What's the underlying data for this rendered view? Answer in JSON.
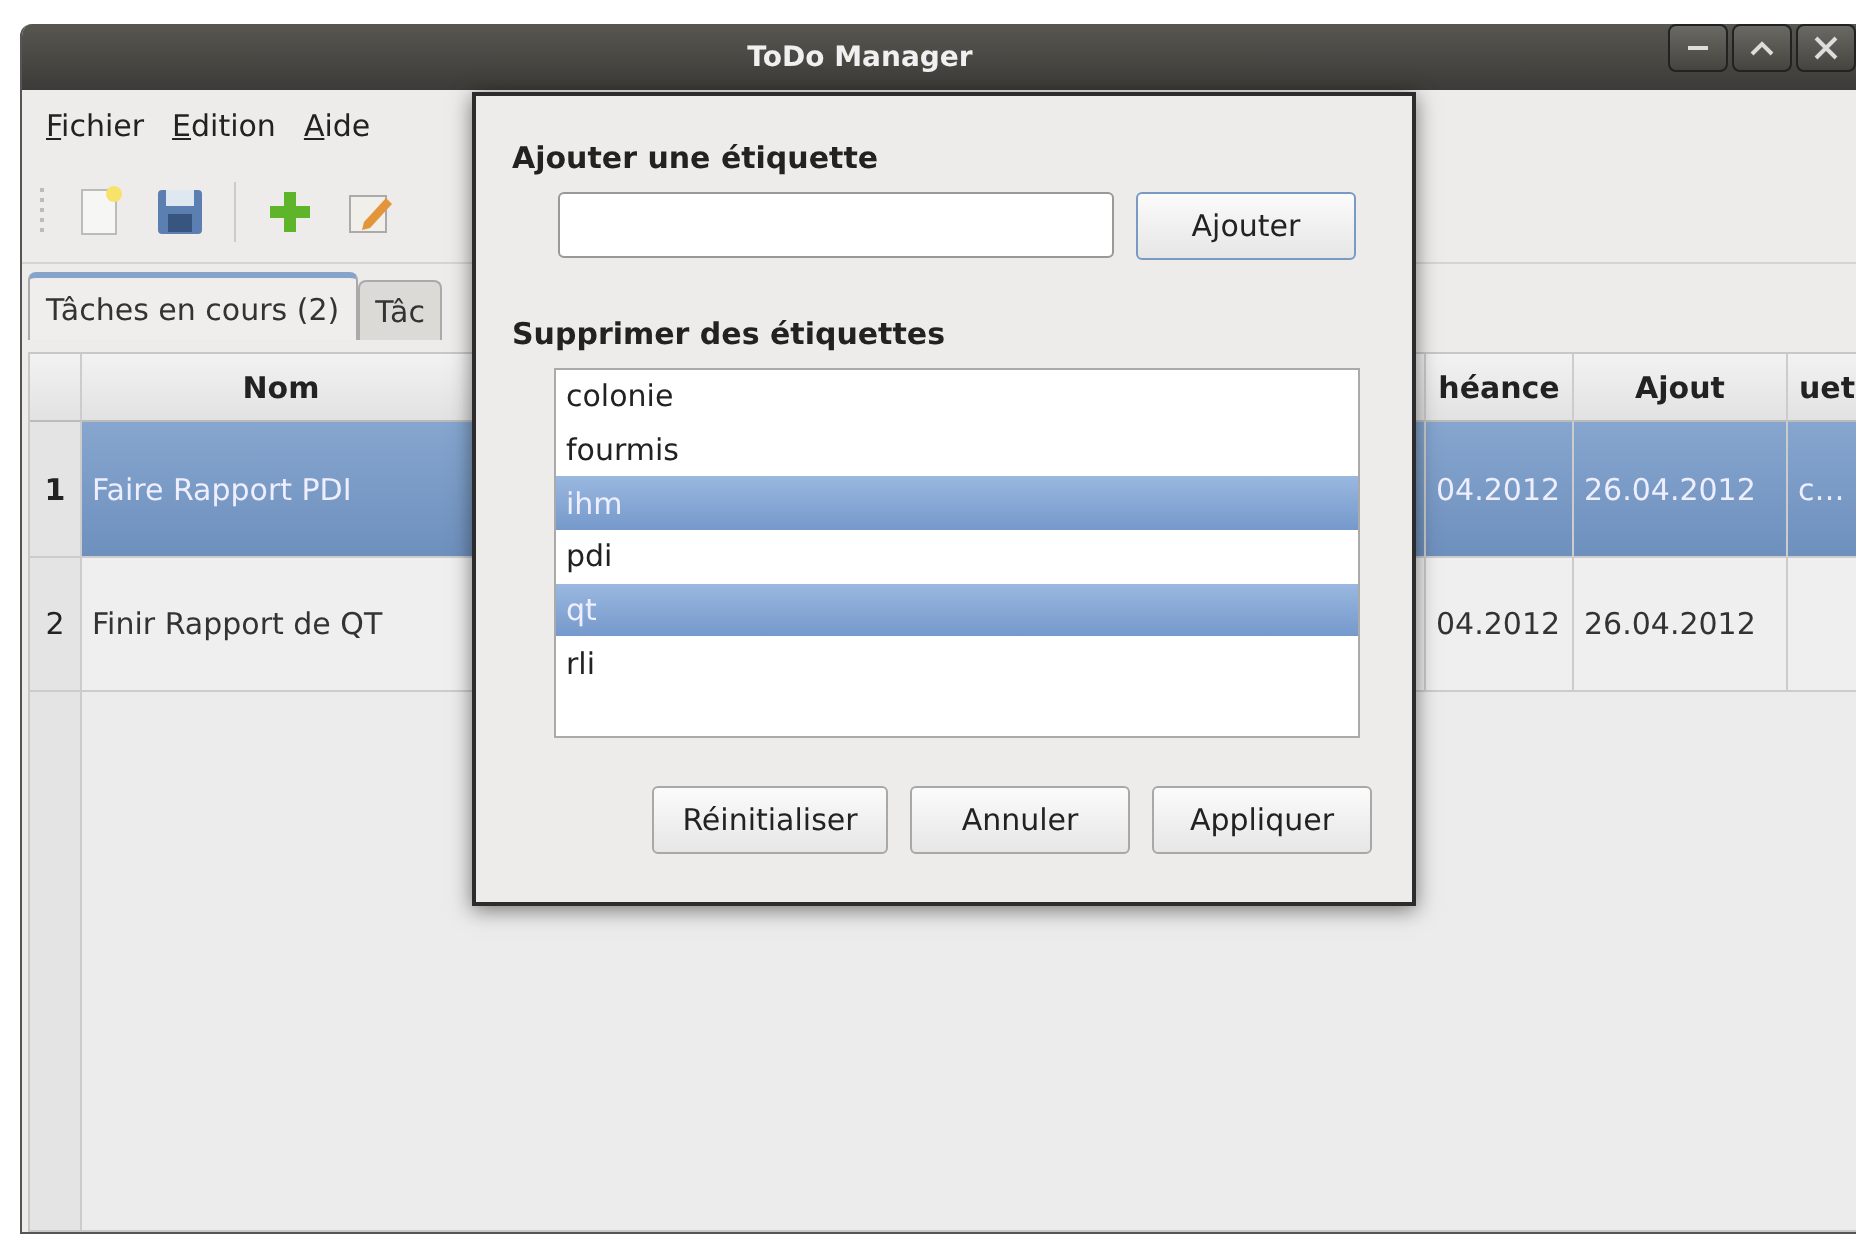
{
  "window": {
    "title": "ToDo Manager"
  },
  "menu": [
    "Fichier",
    "Edition",
    "Aide"
  ],
  "tabs": [
    {
      "label": "Tâches en cours (2)",
      "selected": true
    },
    {
      "label": "Tâc",
      "selected": false
    }
  ],
  "table": {
    "columns": [
      "Nom",
      "héance",
      "Ajout",
      "uet"
    ],
    "rows": [
      {
        "number": "1",
        "selected": true,
        "cells": [
          "Faire Rapport PDI",
          "04.2012",
          "26.04.2012",
          "c…"
        ]
      },
      {
        "number": "2",
        "selected": false,
        "cells": [
          "Finir Rapport de QT",
          "04.2012",
          "26.04.2012"
        ]
      }
    ]
  },
  "dialog": {
    "add_heading": "Ajouter une étiquette",
    "add_button": "Ajouter",
    "remove_heading": "Supprimer des étiquettes",
    "tags": [
      {
        "label": "colonie",
        "selected": false
      },
      {
        "label": "fourmis",
        "selected": false
      },
      {
        "label": "ihm",
        "selected": true
      },
      {
        "label": "pdi",
        "selected": false
      },
      {
        "label": "qt",
        "selected": true
      },
      {
        "label": "rli",
        "selected": false
      }
    ],
    "buttons": [
      "Réinitialiser",
      "Annuler",
      "Appliquer"
    ]
  }
}
